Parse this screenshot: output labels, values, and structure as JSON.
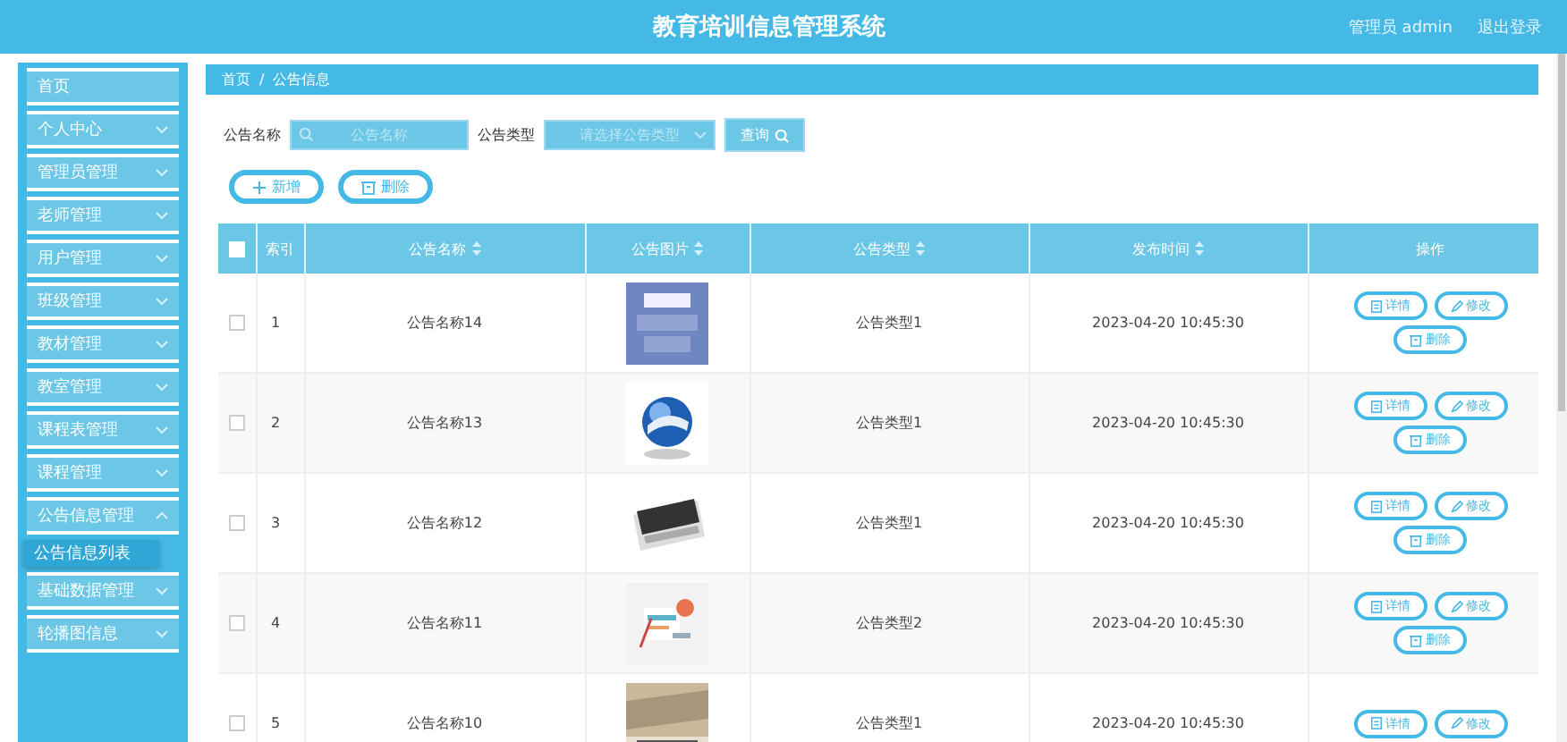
{
  "header": {
    "title": "教育培训信息管理系统",
    "user": "管理员 admin",
    "logout": "退出登录"
  },
  "sidebar": {
    "items": [
      {
        "label": "首页",
        "selected": false
      },
      {
        "label": "个人中心",
        "selected": false,
        "expanded": false
      },
      {
        "label": "管理员管理",
        "selected": false,
        "expanded": false
      },
      {
        "label": "老师管理",
        "selected": false,
        "expanded": false
      },
      {
        "label": "用户管理",
        "selected": false,
        "expanded": false
      },
      {
        "label": "班级管理",
        "selected": false,
        "expanded": false
      },
      {
        "label": "教材管理",
        "selected": false,
        "expanded": false
      },
      {
        "label": "教室管理",
        "selected": false,
        "expanded": false
      },
      {
        "label": "课程表管理",
        "selected": false,
        "expanded": false
      },
      {
        "label": "课程管理",
        "selected": false,
        "expanded": false
      },
      {
        "label": "公告信息管理",
        "selected": false,
        "expanded": true,
        "children": [
          {
            "label": "公告信息列表",
            "selected": true
          }
        ]
      },
      {
        "label": "基础数据管理",
        "selected": false,
        "expanded": false
      },
      {
        "label": "轮播图信息",
        "selected": false,
        "expanded": false
      }
    ]
  },
  "breadcrumb": [
    "首页",
    "/",
    "公告信息"
  ],
  "search": {
    "name_label": "公告名称",
    "name_placeholder": "公告名称",
    "type_label": "公告类型",
    "type_placeholder": "请选择公告类型",
    "button": "查询"
  },
  "actions": [
    "新增",
    "删除"
  ],
  "table": {
    "header_checked": false,
    "columns": [
      "索引",
      "公告名称",
      "公告图片",
      "公告类型",
      "发布时间",
      "操作"
    ],
    "rows": [
      {
        "checked": false,
        "index": "1",
        "name": "公告名称14",
        "image": {
          "kind": "picture"
        },
        "type": "公告类型1",
        "time": "2023-04-20 10:45:30",
        "buttons": [
          "详情",
          "修改",
          "删除"
        ]
      },
      {
        "checked": false,
        "index": "2",
        "name": "公告名称13",
        "image": {
          "kind": "picture"
        },
        "type": "公告类型1",
        "time": "2023-04-20 10:45:30",
        "buttons": [
          "详情",
          "修改",
          "删除"
        ]
      },
      {
        "checked": false,
        "index": "3",
        "name": "公告名称12",
        "image": {
          "kind": "picture"
        },
        "type": "公告类型1",
        "time": "2023-04-20 10:45:30",
        "buttons": [
          "详情",
          "修改",
          "删除"
        ]
      },
      {
        "checked": false,
        "index": "4",
        "name": "公告名称11",
        "image": {
          "kind": "picture"
        },
        "type": "公告类型2",
        "time": "2023-04-20 10:45:30",
        "buttons": [
          "详情",
          "修改",
          "删除"
        ]
      },
      {
        "checked": false,
        "index": "5",
        "name": "公告名称10",
        "image": {
          "kind": "picture"
        },
        "type": "公告类型1",
        "time": "2023-04-20 10:45:30",
        "buttons": [
          "详情",
          "修改"
        ]
      }
    ]
  }
}
